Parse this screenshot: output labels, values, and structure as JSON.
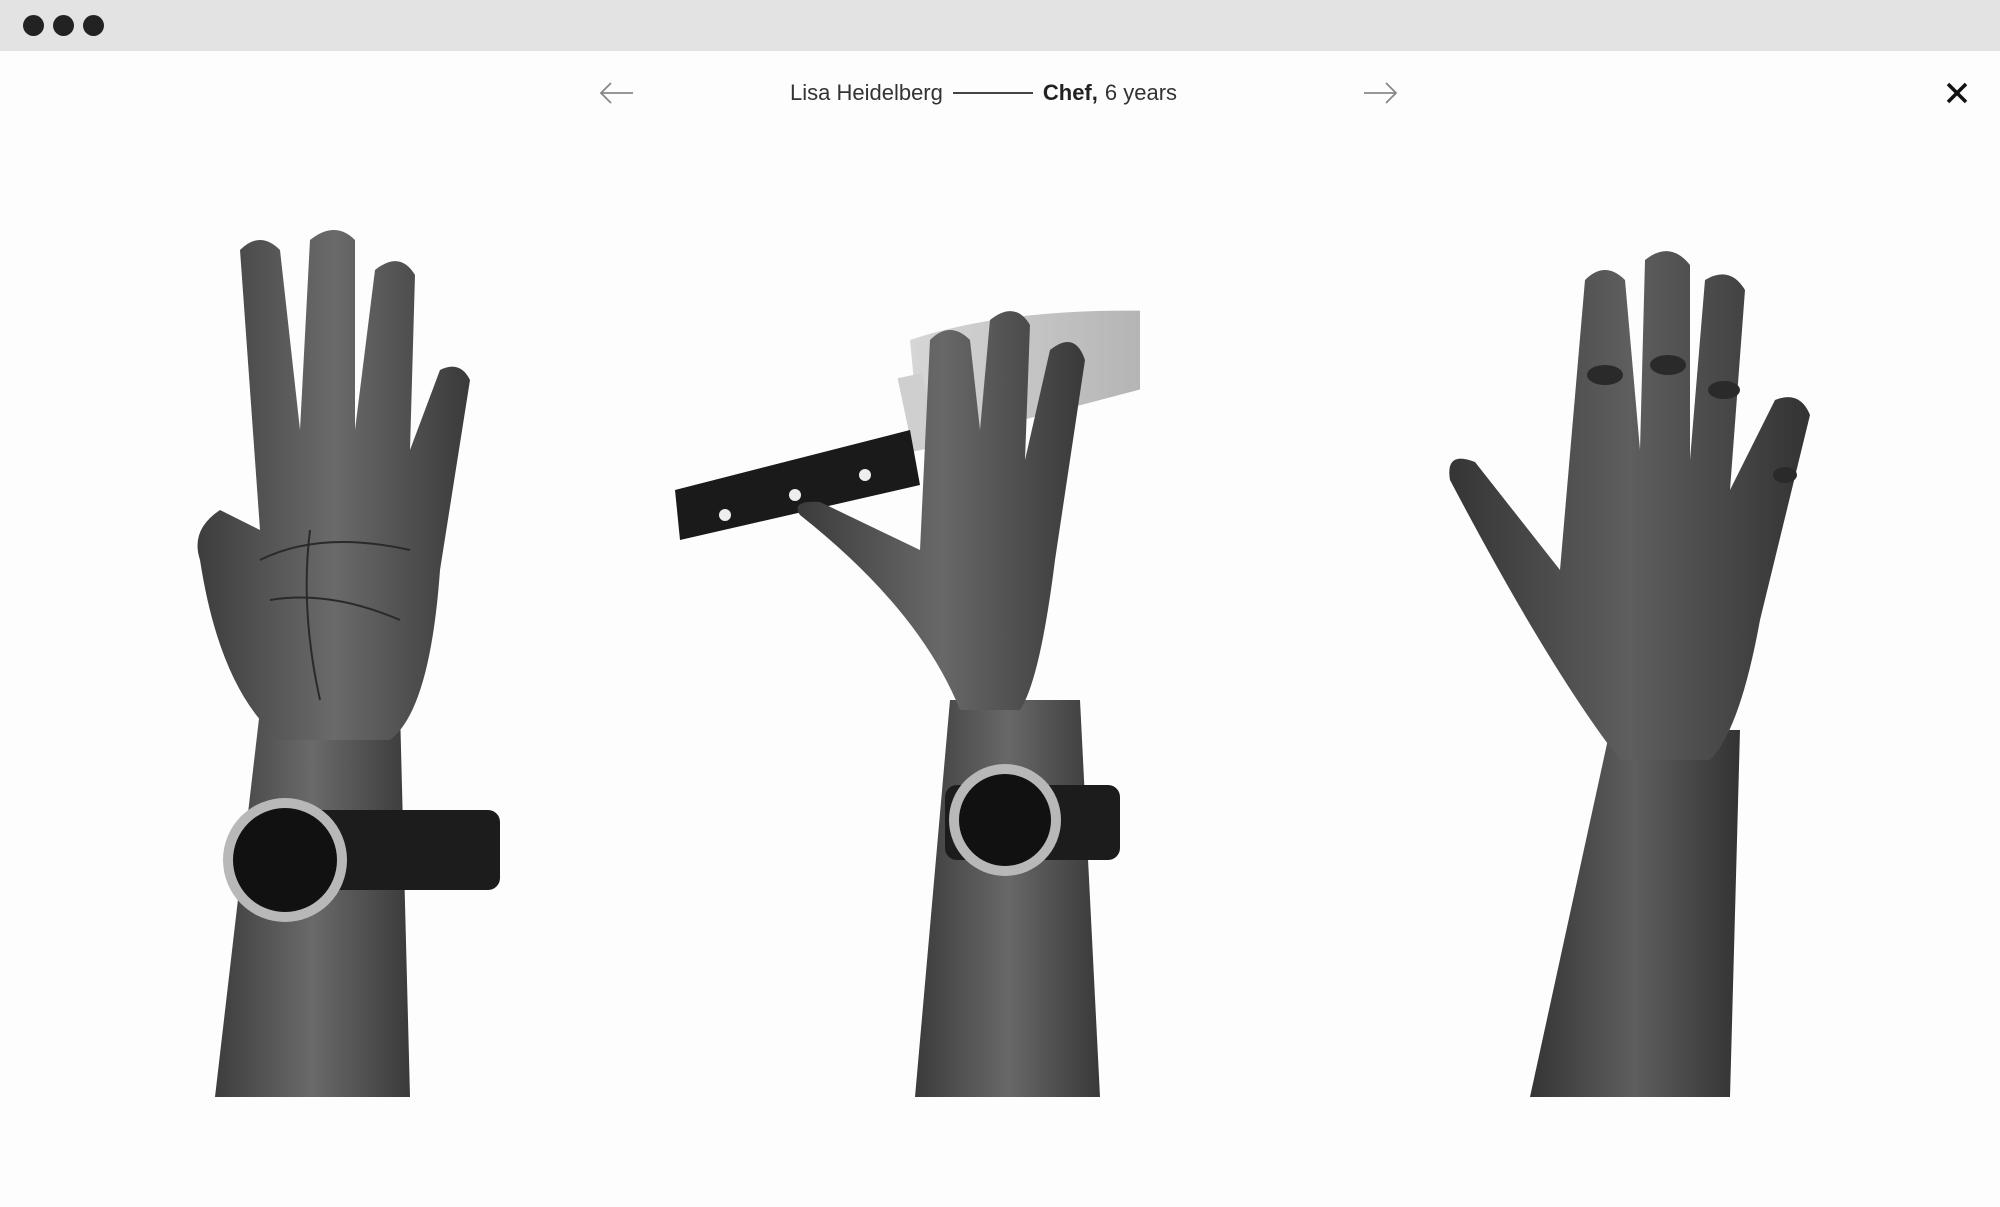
{
  "window": {
    "controls": [
      "close-dot",
      "minimize-dot",
      "zoom-dot"
    ]
  },
  "nav": {
    "prev_icon": "arrow-left-icon",
    "next_icon": "arrow-right-icon",
    "close_icon": "close-icon"
  },
  "caption": {
    "name": "Lisa Heidelberg",
    "role": "Chef,",
    "years": "6 years"
  },
  "photos": [
    {
      "subject": "open-palm-with-watch"
    },
    {
      "subject": "hand-holding-chef-knife-with-watch"
    },
    {
      "subject": "back-of-hand"
    }
  ],
  "colors": {
    "chrome": "#e3e3e3",
    "background": "#fdfdfd",
    "text": "#333333",
    "dots": "#222222"
  }
}
